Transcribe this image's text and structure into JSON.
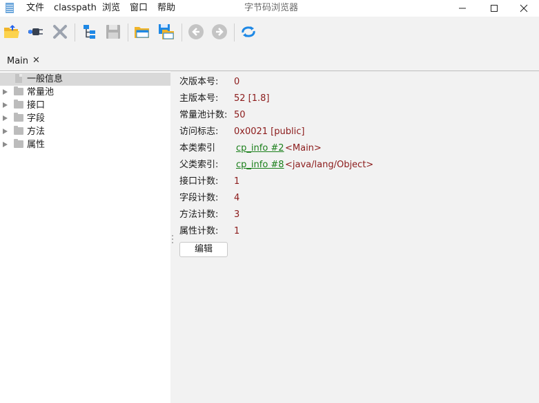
{
  "window": {
    "title": "字节码浏览器"
  },
  "menu": [
    "文件",
    "classpath",
    "浏览",
    "窗口",
    "帮助"
  ],
  "toolbar": {
    "icons": [
      "open-folder-icon",
      "plug-icon",
      "delete-icon",
      "tree-icon",
      "save-icon",
      "open-file-icon",
      "save-as-icon",
      "back-icon",
      "forward-icon",
      "refresh-icon"
    ]
  },
  "tabs": [
    {
      "label": "Main",
      "close": "✕"
    }
  ],
  "tree": {
    "items": [
      {
        "label": "一般信息",
        "type": "file",
        "selected": true
      },
      {
        "label": "常量池",
        "type": "folder"
      },
      {
        "label": "接口",
        "type": "folder"
      },
      {
        "label": "字段",
        "type": "folder"
      },
      {
        "label": "方法",
        "type": "folder"
      },
      {
        "label": "属性",
        "type": "folder"
      }
    ]
  },
  "details": {
    "minor_version": {
      "label": "次版本号:",
      "value": "0"
    },
    "major_version": {
      "label": "主版本号:",
      "value": "52 [1.8]"
    },
    "constant_pool_count": {
      "label": "常量池计数:",
      "value": "50"
    },
    "access_flags": {
      "label": "访问标志:",
      "value": "0x0021 [public]"
    },
    "this_class": {
      "label": "本类索引",
      "link": "cp_info #2",
      "extra": "<Main>"
    },
    "super_class": {
      "label": "父类索引:",
      "link": "cp_info #8",
      "extra": "<java/lang/Object>"
    },
    "interfaces_count": {
      "label": "接口计数:",
      "value": "1"
    },
    "fields_count": {
      "label": "字段计数:",
      "value": "4"
    },
    "methods_count": {
      "label": "方法计数:",
      "value": "3"
    },
    "attributes_count": {
      "label": "属性计数:",
      "value": "1"
    },
    "edit_button": "编辑"
  },
  "colors": {
    "value": "#8b1a1a",
    "link": "#1a7f1a",
    "selection": "#d9d9d9",
    "accent": "#1e88e5"
  }
}
